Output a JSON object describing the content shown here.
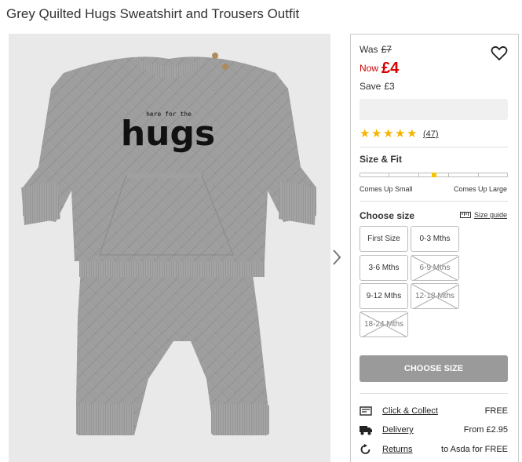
{
  "product": {
    "title": "Grey Quilted Hugs Sweatshirt and Trousers Outfit",
    "print_text_small": "here for the",
    "print_text_big": "hugs"
  },
  "price": {
    "was_label": "Was",
    "was_value": "£7",
    "now_label": "Now",
    "now_value": "£4",
    "save_label": "Save",
    "save_value": "£3"
  },
  "rating": {
    "stars": 5,
    "star_glyph": "★",
    "review_count": "(47)"
  },
  "fit": {
    "title": "Size & Fit",
    "left_label": "Comes Up Small",
    "right_label": "Comes Up Large",
    "position": 0.5
  },
  "sizes": {
    "title": "Choose size",
    "guide_label": "Size guide",
    "options": [
      {
        "label": "First Size",
        "available": true
      },
      {
        "label": "0-3 Mths",
        "available": true
      },
      {
        "label": "3-6 Mths",
        "available": true
      },
      {
        "label": "6-9 Mths",
        "available": false
      },
      {
        "label": "9-12 Mths",
        "available": true
      },
      {
        "label": "12-18 Mths",
        "available": false
      },
      {
        "label": "18-24 Mths",
        "available": false
      }
    ]
  },
  "cta": {
    "choose_size_label": "CHOOSE SIZE"
  },
  "delivery": [
    {
      "icon": "click-collect-icon",
      "label": "Click & Collect",
      "value": "FREE"
    },
    {
      "icon": "truck-icon",
      "label": "Delivery",
      "value": "From £2.95"
    },
    {
      "icon": "returns-icon",
      "label": "Returns",
      "value": "to Asda for FREE"
    }
  ],
  "colors": {
    "price_red": "#d50000",
    "star_gold": "#f5b400",
    "fit_marker": "#f5c400",
    "button_grey": "#9a9a9a"
  }
}
